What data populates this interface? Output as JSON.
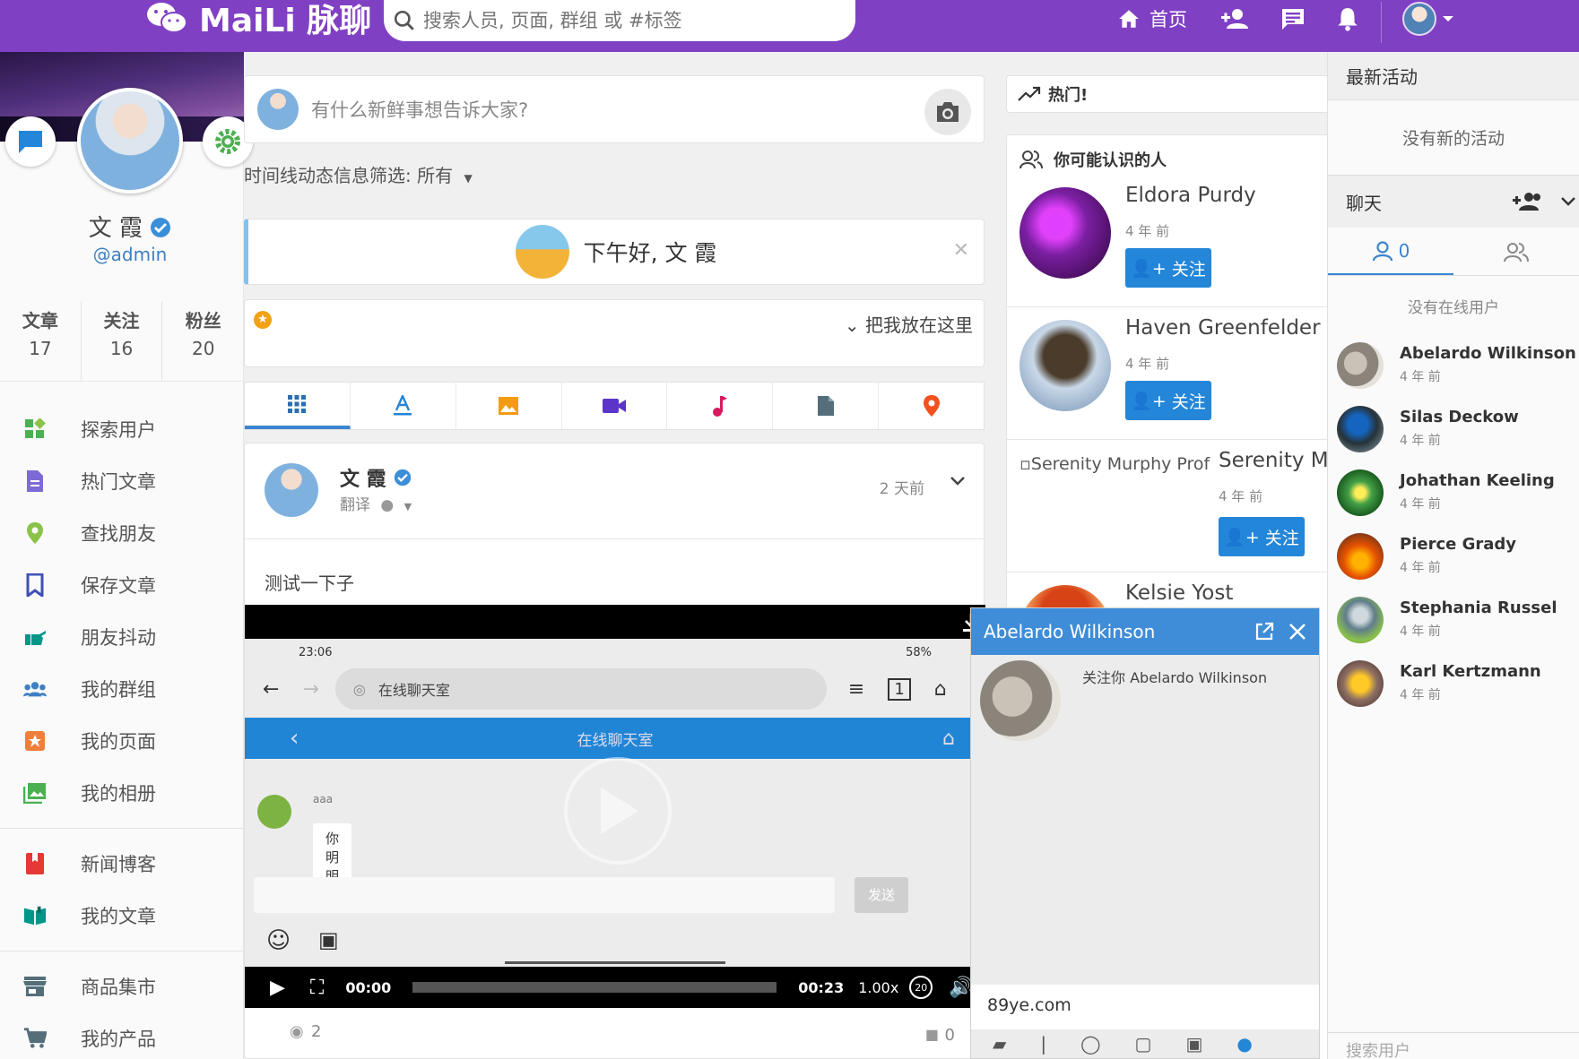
{
  "colors": {
    "brand": "#8040c4",
    "accent": "#2486d8",
    "chat_header": "#3f8dd8"
  },
  "topbar": {
    "brand": "MaiLi 脉聊",
    "search_placeholder": "搜索人员, 页面, 群组 或 #标签",
    "home_label": "首页"
  },
  "profile": {
    "name": "文 霞",
    "handle": "@admin",
    "stats": [
      {
        "label": "文章",
        "value": "17"
      },
      {
        "label": "关注",
        "value": "16"
      },
      {
        "label": "粉丝",
        "value": "20"
      }
    ]
  },
  "menu": {
    "group1": [
      {
        "label": "探索用户",
        "icon": "explore-icon"
      },
      {
        "label": "热门文章",
        "icon": "document-icon"
      },
      {
        "label": "查找朋友",
        "icon": "location-icon"
      },
      {
        "label": "保存文章",
        "icon": "bookmark-icon"
      },
      {
        "label": "朋友抖动",
        "icon": "poke-icon"
      },
      {
        "label": "我的群组",
        "icon": "group-icon"
      },
      {
        "label": "我的页面",
        "icon": "page-icon"
      },
      {
        "label": "我的相册",
        "icon": "album-icon"
      }
    ],
    "group2": [
      {
        "label": "新闻博客",
        "icon": "book-icon"
      },
      {
        "label": "我的文章",
        "icon": "read-icon"
      }
    ],
    "group3": [
      {
        "label": "商品集市",
        "icon": "store-icon"
      },
      {
        "label": "我的产品",
        "icon": "cart-icon"
      }
    ]
  },
  "composer": {
    "placeholder": "有什么新鲜事想告诉大家?"
  },
  "filter": {
    "label": "时间线动态信息筛选: 所有"
  },
  "greeting": {
    "text": "下午好, 文 霞"
  },
  "pin": {
    "label": "把我放在这里"
  },
  "post": {
    "author": "文 霞",
    "privacy": "翻译",
    "time": "2 天前",
    "text": "测试一下子",
    "views": "2",
    "comments": "0",
    "video": {
      "status_time": "23:06",
      "battery": "58%",
      "url_text": "在线聊天室",
      "app_title": "在线聊天室",
      "sender": "aaa",
      "message": "你明明",
      "send_label": "发送",
      "current_time": "00:00",
      "duration": "00:23",
      "speed": "1.00x",
      "rewind": "20",
      "progress": 0
    }
  },
  "trending": {
    "label": "热门!"
  },
  "suggestions": {
    "title": "你可能认识的人",
    "follow_label": "关注",
    "people": [
      {
        "name": "Eldora Purdy",
        "ago": "4 年 前"
      },
      {
        "name": "Haven Greenfelder",
        "ago": "4 年 前"
      },
      {
        "name": "Serenity Mu",
        "ago": "4 年 前",
        "alt": "Serenity Murphy Prof"
      },
      {
        "name": "Kelsie Yost",
        "ago": ""
      }
    ]
  },
  "chat_popup": {
    "name": "Abelardo Wilkinson",
    "note": "关注你 Abelardo Wilkinson",
    "input": "89ye.com"
  },
  "panel": {
    "activity_title": "最新活动",
    "no_activity": "没有新的活动",
    "chat_title": "聊天",
    "online_count": "0",
    "no_online": "没有在线用户",
    "search_placeholder": "搜索用户",
    "users": [
      {
        "name": "Abelardo Wilkinson",
        "ago": "4 年 前"
      },
      {
        "name": "Silas Deckow",
        "ago": "4 年 前"
      },
      {
        "name": "Johathan Keeling",
        "ago": "4 年 前"
      },
      {
        "name": "Pierce Grady",
        "ago": "4 年 前"
      },
      {
        "name": "Stephania Russel",
        "ago": "4 年 前"
      },
      {
        "name": "Karl Kertzmann",
        "ago": "4 年 前"
      }
    ]
  }
}
